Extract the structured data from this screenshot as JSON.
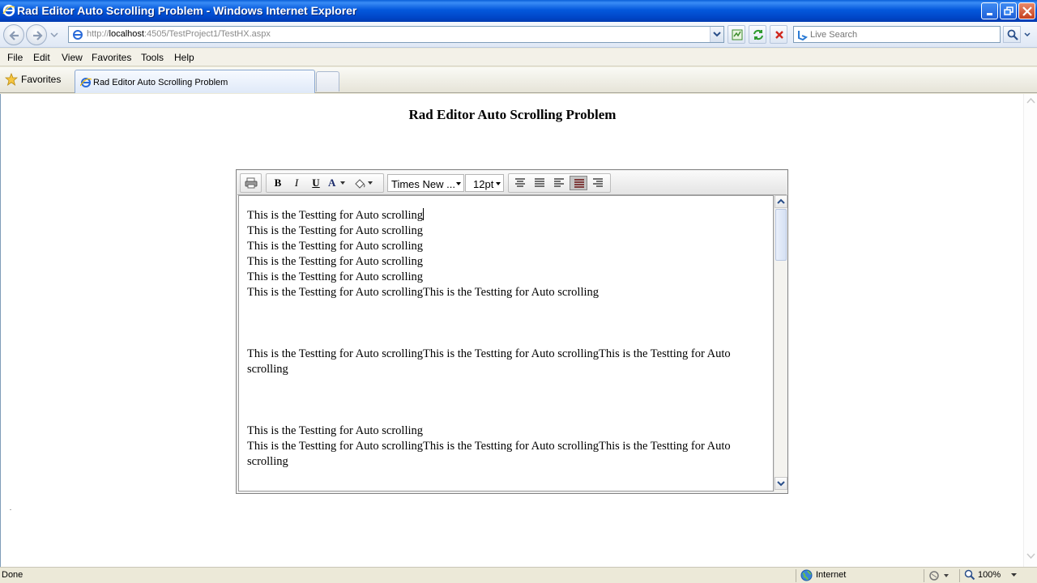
{
  "window": {
    "title": "Rad Editor Auto Scrolling Problem - Windows Internet Explorer"
  },
  "address": {
    "url_prefix": "http://",
    "url_host": "localhost",
    "url_rest": ":4505/TestProject1/TestHX.aspx"
  },
  "search": {
    "placeholder": "Live Search"
  },
  "menu": {
    "items": [
      "File",
      "Edit",
      "View",
      "Favorites",
      "Tools",
      "Help"
    ]
  },
  "favorites_label": "Favorites",
  "tab": {
    "label": "Rad Editor Auto Scrolling Problem"
  },
  "page": {
    "heading": "Rad Editor Auto Scrolling Problem"
  },
  "editor": {
    "font_name": "Times New ...",
    "font_size": "12pt",
    "lines": [
      "This is the Testting for Auto scrolling",
      "This is the Testting for Auto scrolling",
      "This is the Testting for Auto scrolling",
      "This is the Testting for Auto scrolling",
      "This is the Testting for Auto scrolling",
      "This is the Testting for Auto scrollingThis is the Testting for Auto scrolling",
      "This is the Testting for Auto scrollingThis is the Testting for Auto scrollingThis is the Testting for Auto scrolling",
      "This is the Testting for Auto scrolling",
      "This is the Testting for Auto scrollingThis is the Testting for Auto scrollingThis is the Testting for Auto scrolling"
    ],
    "toolbar_icons": [
      "print-icon",
      "bold-icon",
      "italic-icon",
      "underline-icon",
      "fore-color-icon",
      "back-color-icon",
      "align-center-icon",
      "justify-icon",
      "align-left-icon",
      "align-justify-active-icon",
      "align-right-icon"
    ],
    "bold_glyph": "B",
    "italic_glyph": "I",
    "underline_glyph": "U",
    "forecolor_glyph": "A"
  },
  "statusbar": {
    "status": "Done",
    "zone": "Internet",
    "zoom": "100%"
  },
  "colors": {
    "titlebar": "#0054e3",
    "page_background": "#ffffff",
    "chrome": "#ece9d8"
  }
}
